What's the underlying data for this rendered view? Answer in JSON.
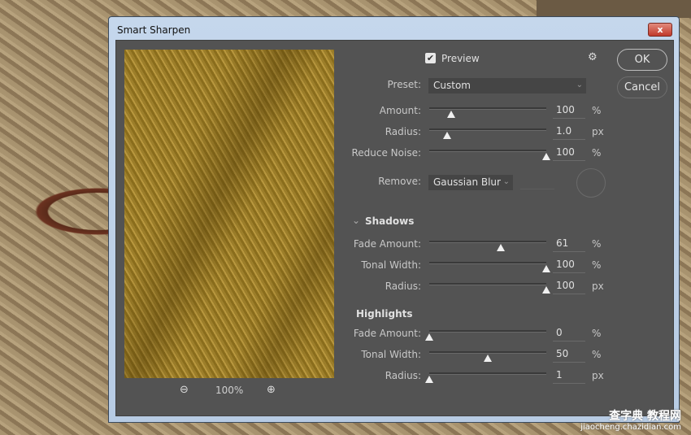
{
  "dialog": {
    "title": "Smart Sharpen",
    "close_label": "x"
  },
  "preview": {
    "zoom_level": "100%",
    "zoom_out_icon": "zoom-out-icon",
    "zoom_in_icon": "zoom-in-icon"
  },
  "controls": {
    "preview_label": "Preview",
    "preview_checked": true,
    "settings_icon": "gear-icon",
    "preset_label": "Preset:",
    "preset_value": "Custom",
    "remove_label": "Remove:",
    "remove_value": "Gaussian Blur"
  },
  "buttons": {
    "ok": "OK",
    "cancel": "Cancel"
  },
  "sliders": [
    {
      "label": "Amount:",
      "value": "100",
      "unit": "%",
      "fraction": 0.19
    },
    {
      "label": "Radius:",
      "value": "1.0",
      "unit": "px",
      "fraction": 0.15
    },
    {
      "label": "Reduce Noise:",
      "value": "100",
      "unit": "%",
      "fraction": 1.0
    }
  ],
  "shadows": {
    "title": "Shadows",
    "sliders": [
      {
        "label": "Fade Amount:",
        "value": "61",
        "unit": "%",
        "fraction": 0.61
      },
      {
        "label": "Tonal Width:",
        "value": "100",
        "unit": "%",
        "fraction": 1.0
      },
      {
        "label": "Radius:",
        "value": "100",
        "unit": "px",
        "fraction": 1.0
      }
    ]
  },
  "highlights": {
    "title": "Highlights",
    "sliders": [
      {
        "label": "Fade Amount:",
        "value": "0",
        "unit": "%",
        "fraction": 0
      },
      {
        "label": "Tonal Width:",
        "value": "50",
        "unit": "%",
        "fraction": 0.5
      },
      {
        "label": "Radius:",
        "value": "1",
        "unit": "px",
        "fraction": 0
      }
    ]
  },
  "watermark": {
    "line1": "查字典 教程网",
    "line2": "jiaocheng.chazidian.com"
  }
}
